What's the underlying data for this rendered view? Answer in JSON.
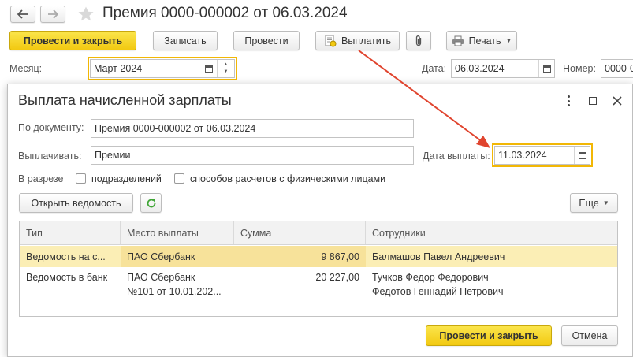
{
  "main_window": {
    "title": "Премия 0000-000002 от 06.03.2024",
    "toolbar": {
      "post_close": "Провести и закрыть",
      "save": "Записать",
      "post": "Провести",
      "pay": "Выплатить",
      "print": "Печать"
    },
    "month_label": "Месяц:",
    "month_value": "Март 2024",
    "date_label": "Дата:",
    "date_value": "06.03.2024",
    "number_label": "Номер:",
    "number_value": "0000-0"
  },
  "dialog": {
    "title": "Выплата начисленной зарплаты",
    "by_document_label": "По документу:",
    "by_document_value": "Премия 0000-000002 от 06.03.2024",
    "pay_label": "Выплачивать:",
    "pay_value": "Премии",
    "pay_date_label": "Дата выплаты:",
    "pay_date_value": "11.03.2024",
    "breakdown_label": "В разрезе",
    "checkbox_divisions": "подразделений",
    "checkbox_methods": "способов расчетов с физическими лицами",
    "open_statement": "Открыть ведомость",
    "more": "Еще",
    "table": {
      "headers": [
        "Тип",
        "Место выплаты",
        "Сумма",
        "Сотрудники"
      ],
      "rows": [
        {
          "type": "Ведомость на с...",
          "place": [
            "ПАО Сбербанк"
          ],
          "sum": "9 867,00",
          "employees": [
            "Балмашов Павел Андреевич"
          ]
        },
        {
          "type": "Ведомость в банк",
          "place": [
            "ПАО Сбербанк",
            "№101 от 10.01.202..."
          ],
          "sum": "20 227,00",
          "employees": [
            "Тучков Федор Федорович",
            "Федотов Геннадий Петрович"
          ]
        }
      ]
    },
    "post_close": "Провести и закрыть",
    "cancel": "Отмена"
  },
  "colors": {
    "accent_yellow": "#f2c911",
    "highlight_outline": "#f2b705",
    "selected_row": "#fbeeb5",
    "arrow": "#e0442e"
  },
  "icons": [
    "back-arrow-icon",
    "forward-arrow-icon",
    "star-icon",
    "pay-icon",
    "paperclip-icon",
    "printer-icon",
    "calendar-icon",
    "refresh-icon",
    "more-vertical-icon",
    "maximize-icon",
    "close-icon"
  ]
}
